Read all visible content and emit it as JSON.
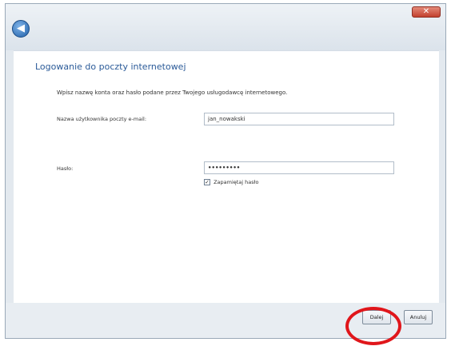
{
  "window": {
    "close_icon": "close-icon",
    "back_icon": "back-arrow-icon",
    "accent": "#2a5a98"
  },
  "page": {
    "title": "Logowanie do poczty internetowej",
    "instruction": "Wpisz nazwę konta oraz hasło podane przez Twojego usługodawcę internetowego."
  },
  "form": {
    "username_label": "Nazwa użytkownika poczty e-mail:",
    "username_value": "jan_nowakski",
    "password_label": "Hasło:",
    "password_value": "•••••••••",
    "remember_label": "Zapamiętaj hasło",
    "remember_checked": true
  },
  "footer": {
    "next_label": "Dalej",
    "cancel_label": "Anuluj"
  },
  "annotation": {
    "highlight_color": "#e0161b"
  }
}
